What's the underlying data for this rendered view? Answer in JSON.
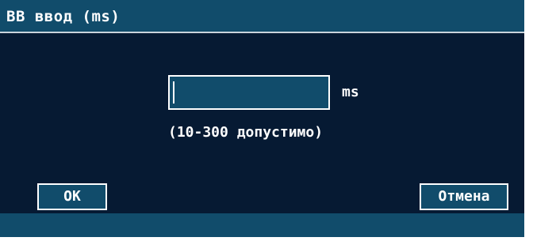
{
  "dialog": {
    "title": "ВВ ввод (ms)",
    "input_value": "",
    "unit": "ms",
    "range_hint": "(10-300 допустимо)",
    "ok_label": "OK",
    "cancel_label": "Отмена"
  },
  "colors": {
    "background": "#061a33",
    "titlebar": "#114c6b",
    "accent": "#114c6b",
    "text": "#ffffff"
  }
}
